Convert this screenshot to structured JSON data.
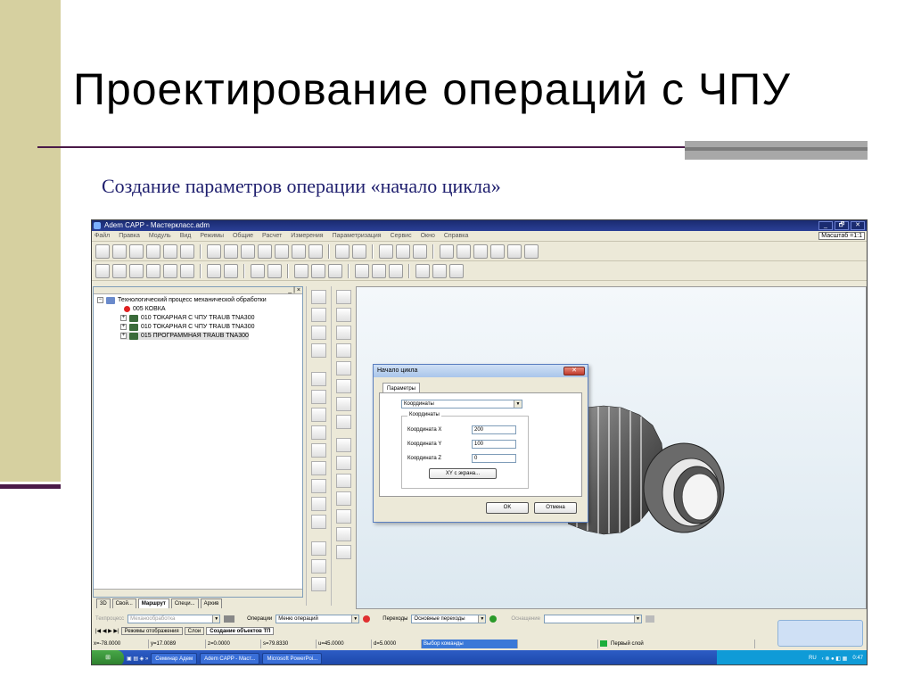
{
  "slide": {
    "title": "Проектирование операций с ЧПУ",
    "subtitle": "Создание параметров операции «начало цикла»"
  },
  "app": {
    "window_title": "Adem CAPP - Мастеркласс.adm",
    "window_buttons": [
      "_",
      "🗗",
      "✕"
    ],
    "menu": [
      "Файл",
      "Правка",
      "Модуль",
      "Вид",
      "Режимы",
      "Общие",
      "Расчет",
      "Измерения",
      "Параметризация",
      "Сервис",
      "Окно",
      "Справка"
    ],
    "scale_label": "Масштаб =1:1",
    "tree": {
      "root": "Технологический процесс механической обработки",
      "items": [
        "005  КОВКА",
        "010  ТОКАРНАЯ С ЧПУ TRAUB TNA300",
        "010  ТОКАРНАЯ С ЧПУ TRAUB TNA300",
        "015  ПРОГРАММНАЯ TRAUB TNA300"
      ]
    },
    "panel_tabs": [
      "3D",
      "Свой...",
      "Маршрут",
      "Специ...",
      "Архив"
    ],
    "dialog": {
      "title": "Начало цикла",
      "close": "✕",
      "tab": "Параметры",
      "select_value": "Координаты",
      "group_label": "Координаты",
      "fields": [
        {
          "label": "Координата X",
          "value": "200"
        },
        {
          "label": "Координата Y",
          "value": "100"
        },
        {
          "label": "Координата Z",
          "value": "0"
        }
      ],
      "xy_button": "XY с экрана...",
      "ok": "OK",
      "cancel": "Отмена"
    },
    "bottom": {
      "techproc_label": "Техпроцесс",
      "techproc_value": "Механообработка",
      "operations_label": "Операции",
      "operations_value": "Меню операций",
      "transitions_label": "Переходы",
      "transitions_value": "Основные переходы",
      "equipment_label": "Оснащение",
      "tabs": [
        "Режимы отображения",
        "Слои",
        "Создание объектов ТП"
      ]
    },
    "status": {
      "x": "x=-78.0000",
      "y": "y=17.0089",
      "z": "z=0.0000",
      "s": "s=79.8330",
      "u": "u=45.0000",
      "d": "d=5.0000",
      "command": "Выбор команды",
      "layer": "Первый слой"
    },
    "taskbar": {
      "items": [
        "Семинар Адем",
        "Adem CAPP - Маст...",
        "Microsoft PowerPoi..."
      ],
      "lang": "RU",
      "time": "0:47"
    }
  }
}
